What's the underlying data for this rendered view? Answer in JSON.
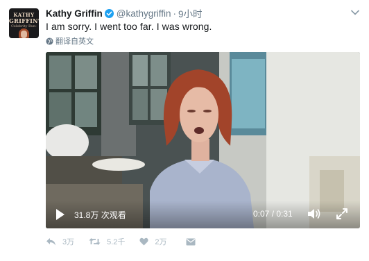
{
  "tweet": {
    "author_name": "Kathy Griffin",
    "handle": "@kathygriffin",
    "separator": "·",
    "time": "9小时",
    "text": "I am sorry.  I went too far.  I was wrong.",
    "translate_label": "翻译自英文",
    "avatar": {
      "line1": "KATHY",
      "line2": "GRIFFIN'S",
      "line3": "Celebrity Run-Ins"
    }
  },
  "video": {
    "views": "31.8万 次观看",
    "time": "0:07 / 0:31",
    "progress": 0.226
  },
  "actions": {
    "reply_count": "3万",
    "retweet_count": "5.2千",
    "like_count": "2万"
  },
  "colors": {
    "verified": "#1da1f2",
    "secondary_text": "#657786",
    "action_icon": "#aab8c2"
  }
}
